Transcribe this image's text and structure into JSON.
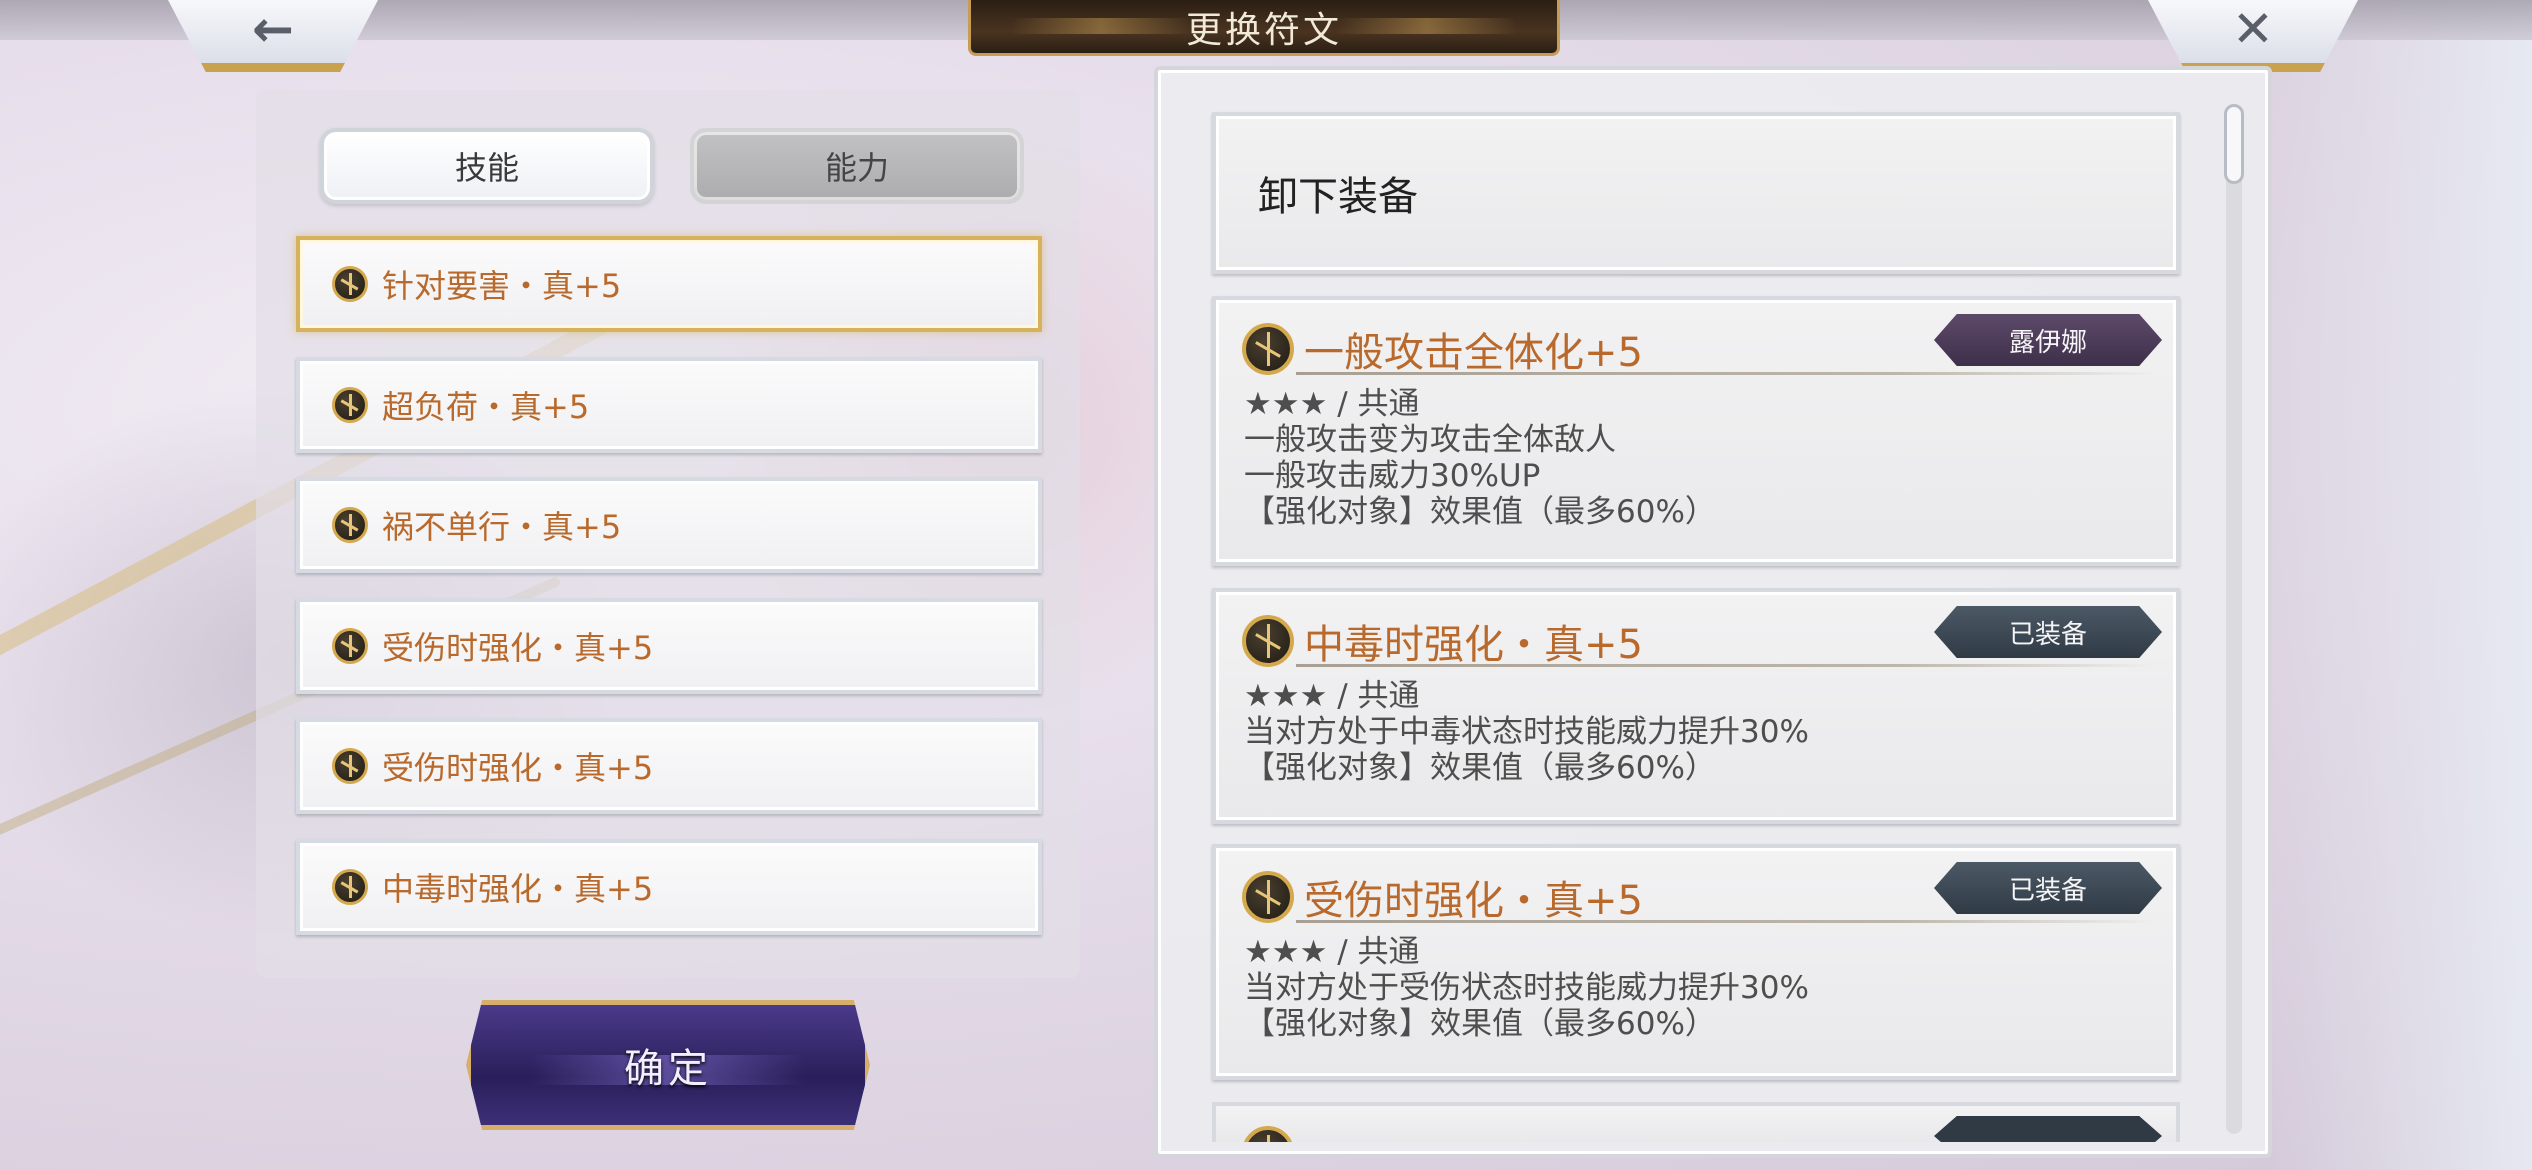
{
  "header": {
    "title": "更换符文",
    "back_icon": "arrow-left-icon",
    "close_icon": "close-icon",
    "back_glyph": "←",
    "close_glyph": "✕"
  },
  "tabs": [
    {
      "label": "技能",
      "active": true
    },
    {
      "label": "能力",
      "active": false
    }
  ],
  "rune_list": [
    {
      "label": "针对要害・真+5",
      "selected": true
    },
    {
      "label": "超负荷・真+5",
      "selected": false
    },
    {
      "label": "祸不单行・真+5",
      "selected": false
    },
    {
      "label": "受伤时强化・真+5",
      "selected": false
    },
    {
      "label": "受伤时强化・真+5",
      "selected": false
    },
    {
      "label": "中毒时强化・真+5",
      "selected": false
    }
  ],
  "confirm_label": "确定",
  "detail_panel": {
    "unequip_label": "卸下装备",
    "cards": [
      {
        "name": "一般攻击全体化+5",
        "badge": "露伊娜",
        "badge_style": "purple",
        "rarity_line": "★★★ / 共通",
        "lines": [
          "一般攻击变为攻击全体敌人",
          "一般攻击威力30%UP",
          "【强化对象】效果值（最多60%）"
        ]
      },
      {
        "name": "中毒时强化・真+5",
        "badge": "已装备",
        "badge_style": "slate",
        "rarity_line": "★★★ / 共通",
        "lines": [
          "当对方处于中毒状态时技能威力提升30%",
          "【强化对象】效果值（最多60%）"
        ]
      },
      {
        "name": "受伤时强化・真+5",
        "badge": "已装备",
        "badge_style": "slate",
        "rarity_line": "★★★ / 共通",
        "lines": [
          "当对方处于受伤状态时技能威力提升30%",
          "【强化对象】效果值（最多60%）"
        ]
      }
    ]
  },
  "colors": {
    "rune_name": "#b8692b",
    "gold_border": "#d7b25e",
    "confirm_bg": "#2a1f5a",
    "title_bg": "#2a1e14"
  },
  "icons": {
    "rune": "rune-emblem-icon"
  }
}
